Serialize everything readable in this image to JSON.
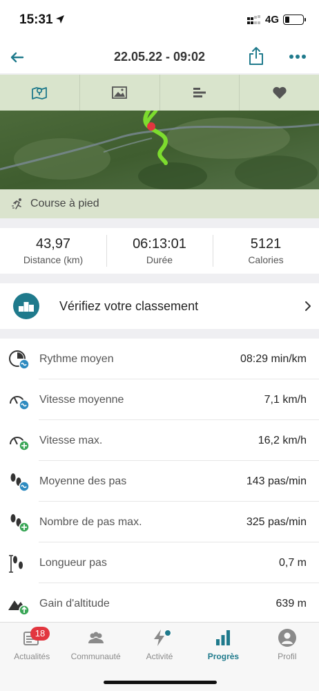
{
  "status_bar": {
    "time": "15:31",
    "network": "4G"
  },
  "header": {
    "title": "22.05.22 - 09:02"
  },
  "tabs": [
    {
      "icon": "map-icon"
    },
    {
      "icon": "photo-icon"
    },
    {
      "icon": "bar-chart-icon"
    },
    {
      "icon": "heart-icon"
    }
  ],
  "activity": {
    "type_label": "Course à pied"
  },
  "summary": {
    "distance": {
      "value": "43,97",
      "label": "Distance (km)"
    },
    "duration": {
      "value": "06:13:01",
      "label": "Durée"
    },
    "calories": {
      "value": "5121",
      "label": "Calories"
    }
  },
  "ranking": {
    "label": "Vérifiez votre classement"
  },
  "metrics": [
    {
      "label": "Rythme moyen",
      "value": "08:29 min/km",
      "icon": "pace-avg-icon"
    },
    {
      "label": "Vitesse moyenne",
      "value": "7,1 km/h",
      "icon": "speed-avg-icon"
    },
    {
      "label": "Vitesse max.",
      "value": "16,2 km/h",
      "icon": "speed-max-icon"
    },
    {
      "label": "Moyenne des pas",
      "value": "143 pas/min",
      "icon": "steps-avg-icon"
    },
    {
      "label": "Nombre de pas max.",
      "value": "325 pas/min",
      "icon": "steps-max-icon"
    },
    {
      "label": "Longueur pas",
      "value": "0,7 m",
      "icon": "step-length-icon"
    },
    {
      "label": "Gain d'altitude",
      "value": "639 m",
      "icon": "altitude-gain-icon"
    }
  ],
  "bottom_nav": {
    "news": {
      "label": "Actualités",
      "badge": "18"
    },
    "community": {
      "label": "Communauté"
    },
    "activity": {
      "label": "Activité"
    },
    "progress": {
      "label": "Progrès"
    },
    "profile": {
      "label": "Profil"
    }
  },
  "colors": {
    "accent": "#1f7a8c",
    "badge": "#e2363f",
    "route": "#7ddc2e",
    "tab_bar": "#d9e4cc"
  }
}
